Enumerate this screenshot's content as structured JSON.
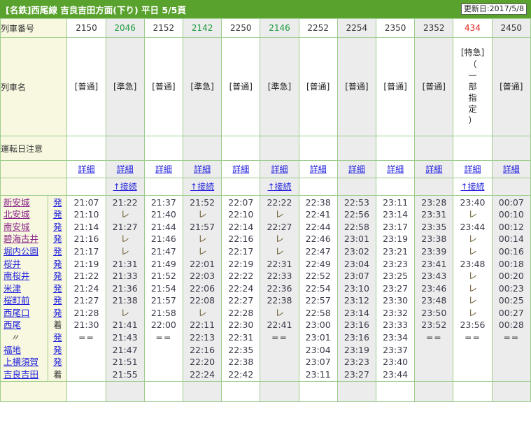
{
  "header": {
    "title": "[名鉄]西尾線 吉良吉田方面(下り) 平日 5/5頁",
    "updated_label": "更新日:2017/5/8"
  },
  "row_labels": {
    "train_number": "列車番号",
    "train_name": "列車名",
    "operation_notes": "運転日注意"
  },
  "links": {
    "detail": "詳細",
    "connection": "↑接続"
  },
  "colors": {
    "brand_green": "#5aa22e",
    "grid_green": "#9ccd8c",
    "label_bg": "#f8f8e0",
    "col_shade": "#ececec",
    "link_blue": "#2222dd",
    "visited_purple": "#8b268b",
    "train_green": "#1a9a3c",
    "train_red": "#e2231a"
  },
  "stations": [
    {
      "name": "新安城",
      "mark": "発",
      "mark_type": "dep",
      "visited": true,
      "ditto": false
    },
    {
      "name": "北安城",
      "mark": "発",
      "mark_type": "dep",
      "visited": true,
      "ditto": false
    },
    {
      "name": "南安城",
      "mark": "発",
      "mark_type": "dep",
      "visited": true,
      "ditto": false
    },
    {
      "name": "碧海古井",
      "mark": "発",
      "mark_type": "dep",
      "visited": true,
      "ditto": false
    },
    {
      "name": "堀内公園",
      "mark": "発",
      "mark_type": "dep",
      "visited": false,
      "ditto": false
    },
    {
      "name": "桜井",
      "mark": "発",
      "mark_type": "dep",
      "visited": false,
      "ditto": false
    },
    {
      "name": "南桜井",
      "mark": "発",
      "mark_type": "dep",
      "visited": false,
      "ditto": false
    },
    {
      "name": "米津",
      "mark": "発",
      "mark_type": "dep",
      "visited": false,
      "ditto": false
    },
    {
      "name": "桜町前",
      "mark": "発",
      "mark_type": "dep",
      "visited": false,
      "ditto": false
    },
    {
      "name": "西尾口",
      "mark": "発",
      "mark_type": "dep",
      "visited": false,
      "ditto": false
    },
    {
      "name": "西尾",
      "mark": "着",
      "mark_type": "arr",
      "visited": false,
      "ditto": false
    },
    {
      "name": "〃",
      "mark": "発",
      "mark_type": "dep",
      "visited": false,
      "ditto": true
    },
    {
      "name": "福地",
      "mark": "発",
      "mark_type": "dep",
      "visited": false,
      "ditto": false
    },
    {
      "name": "上横須賀",
      "mark": "発",
      "mark_type": "dep",
      "visited": false,
      "ditto": false
    },
    {
      "name": "吉良吉田",
      "mark": "着",
      "mark_type": "arr",
      "visited": false,
      "ditto": false
    }
  ],
  "columns": [
    {
      "train_number": "2150",
      "number_color": "default",
      "shade": "white",
      "type_label": "[普通]",
      "vertical_note": "",
      "has_detail": true,
      "has_connection": false,
      "times": [
        "21:07",
        "21:10",
        "21:14",
        "21:16",
        "21:17",
        "21:19",
        "21:22",
        "21:24",
        "21:27",
        "21:28",
        "21:30",
        "==",
        "",
        "",
        ""
      ]
    },
    {
      "train_number": "2046",
      "number_color": "green",
      "shade": "grey",
      "type_label": "[準急]",
      "vertical_note": "",
      "has_detail": true,
      "has_connection": true,
      "times": [
        "21:22",
        "レ",
        "21:27",
        "レ",
        "レ",
        "21:31",
        "21:33",
        "21:36",
        "21:38",
        "レ",
        "21:41",
        "21:43",
        "21:47",
        "21:51",
        "21:55"
      ]
    },
    {
      "train_number": "2152",
      "number_color": "default",
      "shade": "white",
      "type_label": "[普通]",
      "vertical_note": "",
      "has_detail": true,
      "has_connection": false,
      "times": [
        "21:37",
        "21:40",
        "21:44",
        "21:46",
        "21:47",
        "21:49",
        "21:52",
        "21:54",
        "21:57",
        "21:58",
        "22:00",
        "==",
        "",
        "",
        ""
      ]
    },
    {
      "train_number": "2142",
      "number_color": "green",
      "shade": "grey",
      "type_label": "[準急]",
      "vertical_note": "",
      "has_detail": true,
      "has_connection": true,
      "times": [
        "21:52",
        "レ",
        "21:57",
        "レ",
        "レ",
        "22:01",
        "22:03",
        "22:06",
        "22:08",
        "レ",
        "22:11",
        "22:13",
        "22:16",
        "22:20",
        "22:24"
      ]
    },
    {
      "train_number": "2250",
      "number_color": "default",
      "shade": "white",
      "type_label": "[普通]",
      "vertical_note": "",
      "has_detail": true,
      "has_connection": false,
      "times": [
        "22:07",
        "22:10",
        "22:14",
        "22:16",
        "22:17",
        "22:19",
        "22:22",
        "22:24",
        "22:27",
        "22:28",
        "22:30",
        "22:31",
        "22:35",
        "22:38",
        "22:42"
      ]
    },
    {
      "train_number": "2146",
      "number_color": "green",
      "shade": "grey",
      "type_label": "[準急]",
      "vertical_note": "",
      "has_detail": true,
      "has_connection": true,
      "times": [
        "22:22",
        "レ",
        "22:27",
        "レ",
        "レ",
        "22:31",
        "22:33",
        "22:36",
        "22:38",
        "レ",
        "22:41",
        "==",
        "",
        "",
        ""
      ]
    },
    {
      "train_number": "2252",
      "number_color": "default",
      "shade": "white",
      "type_label": "[普通]",
      "vertical_note": "",
      "has_detail": true,
      "has_connection": false,
      "times": [
        "22:38",
        "22:41",
        "22:44",
        "22:46",
        "22:47",
        "22:49",
        "22:52",
        "22:54",
        "22:57",
        "22:58",
        "23:00",
        "23:01",
        "23:04",
        "23:07",
        "23:11"
      ]
    },
    {
      "train_number": "2254",
      "number_color": "default",
      "shade": "grey",
      "type_label": "[普通]",
      "vertical_note": "",
      "has_detail": true,
      "has_connection": false,
      "times": [
        "22:53",
        "22:56",
        "22:58",
        "23:01",
        "23:02",
        "23:04",
        "23:07",
        "23:10",
        "23:12",
        "23:14",
        "23:16",
        "23:16",
        "23:19",
        "23:23",
        "23:27"
      ]
    },
    {
      "train_number": "2350",
      "number_color": "default",
      "shade": "white",
      "type_label": "[普通]",
      "vertical_note": "",
      "has_detail": true,
      "has_connection": false,
      "times": [
        "23:11",
        "23:14",
        "23:17",
        "23:19",
        "23:21",
        "23:23",
        "23:25",
        "23:27",
        "23:30",
        "23:32",
        "23:33",
        "23:34",
        "23:37",
        "23:40",
        "23:44"
      ]
    },
    {
      "train_number": "2352",
      "number_color": "default",
      "shade": "grey",
      "type_label": "[普通]",
      "vertical_note": "",
      "has_detail": true,
      "has_connection": false,
      "times": [
        "23:28",
        "23:31",
        "23:35",
        "23:38",
        "23:39",
        "23:41",
        "23:43",
        "23:46",
        "23:48",
        "23:50",
        "23:52",
        "==",
        "",
        "",
        ""
      ]
    },
    {
      "train_number": "434",
      "number_color": "red",
      "shade": "white",
      "type_label": "[特急]",
      "vertical_note": "（一部指定）",
      "has_detail": true,
      "has_connection": true,
      "times": [
        "23:40",
        "レ",
        "23:44",
        "レ",
        "レ",
        "23:48",
        "レ",
        "レ",
        "レ",
        "レ",
        "23:56",
        "==",
        "",
        "",
        ""
      ]
    },
    {
      "train_number": "2450",
      "number_color": "default",
      "shade": "grey",
      "type_label": "[普通]",
      "vertical_note": "",
      "has_detail": true,
      "has_connection": false,
      "times": [
        "00:07",
        "00:10",
        "00:12",
        "00:14",
        "00:16",
        "00:18",
        "00:20",
        "00:23",
        "00:25",
        "00:27",
        "00:28",
        "==",
        "",
        "",
        ""
      ]
    }
  ]
}
